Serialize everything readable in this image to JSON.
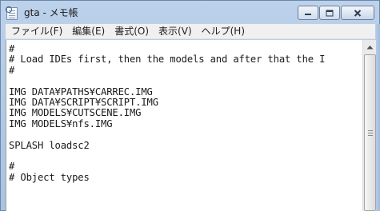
{
  "window": {
    "title": "gta - メモ帳"
  },
  "menu": {
    "items": [
      {
        "label": "ファイル(F)"
      },
      {
        "label": "編集(E)"
      },
      {
        "label": "書式(O)"
      },
      {
        "label": "表示(V)"
      },
      {
        "label": "ヘルプ(H)"
      }
    ]
  },
  "editor": {
    "lines": [
      "#",
      "# Load IDEs first, then the models and after that the I",
      "#",
      "",
      "IMG DATA¥PATHS¥CARREC.IMG",
      "IMG DATA¥SCRIPT¥SCRIPT.IMG",
      "IMG MODELS¥CUTSCENE.IMG",
      "IMG MODELS¥nfs.IMG",
      "",
      "SPLASH loadsc2",
      "",
      "#",
      "# Object types"
    ]
  },
  "icons": {
    "app": "notepad-icon",
    "minimize": "minimize-icon",
    "maximize": "maximize-icon",
    "close": "close-icon",
    "scroll_up": "scroll-up-arrow-icon"
  },
  "colors": {
    "titlebar": "#b3cbe8",
    "menubar": "#f0f0f0",
    "editor_bg": "#ffffff",
    "text": "#1a1a1a"
  }
}
